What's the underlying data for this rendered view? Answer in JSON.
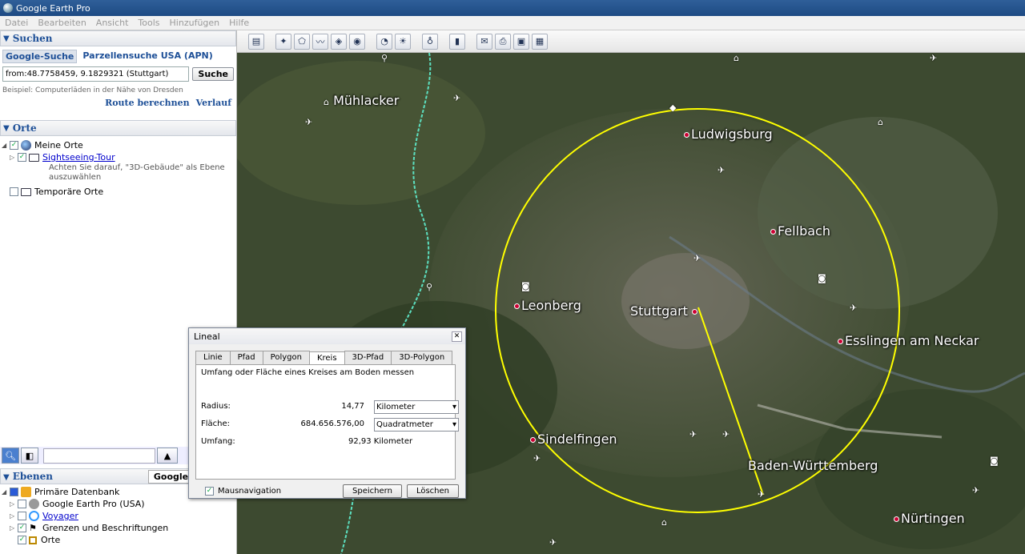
{
  "window": {
    "title": "Google Earth Pro"
  },
  "menu": [
    "Datei",
    "Bearbeiten",
    "Ansicht",
    "Tools",
    "Hinzufügen",
    "Hilfe"
  ],
  "search_panel": {
    "title": "Suchen",
    "tabs": [
      "Google-Suche",
      "Parzellensuche USA (APN)"
    ],
    "input_value": "from:48.7758459, 9.1829321 (Stuttgart)",
    "search_button": "Suche",
    "hint": "Beispiel: Computerläden in der Nähe von Dresden",
    "route_link": "Route berechnen",
    "history_link": "Verlauf"
  },
  "places_panel": {
    "title": "Orte",
    "my_places": "Meine Orte",
    "sightseeing": "Sightseeing-Tour",
    "note": "Achten Sie darauf, \"3D-Gebäude\" als Ebene auszuwählen",
    "temp_places": "Temporäre Orte"
  },
  "layers_panel": {
    "title": "Ebenen",
    "gallery_button": "Google Earth-G",
    "items": [
      {
        "label": "Primäre Datenbank"
      },
      {
        "label": "Google Earth Pro (USA)"
      },
      {
        "label": "Voyager"
      },
      {
        "label": "Grenzen und Beschriftungen"
      },
      {
        "label": "Orte"
      }
    ]
  },
  "map": {
    "cities": {
      "muehlacker": "Mühlacker",
      "ludwigsburg": "Ludwigsburg",
      "fellbach": "Fellbach",
      "leonberg": "Leonberg",
      "stuttgart": "Stuttgart",
      "esslingen": "Esslingen am Neckar",
      "sindelfingen": "Sindelfingen",
      "bw": "Baden-Württemberg",
      "nuertingen": "Nürtingen"
    },
    "circle_color": "#ffff00"
  },
  "ruler": {
    "title": "Lineal",
    "tabs": [
      "Linie",
      "Pfad",
      "Polygon",
      "Kreis",
      "3D-Pfad",
      "3D-Polygon"
    ],
    "active_tab": "Kreis",
    "description": "Umfang oder Fläche eines Kreises am Boden messen",
    "radius_label": "Radius:",
    "radius_value": "14,77",
    "radius_unit": "Kilometer",
    "area_label": "Fläche:",
    "area_value": "684.656.576,00",
    "area_unit": "Quadratmeter",
    "perimeter_label": "Umfang:",
    "perimeter_value": "92,93 Kilometer",
    "mouse_nav": "Mausnavigation",
    "save": "Speichern",
    "delete": "Löschen"
  }
}
